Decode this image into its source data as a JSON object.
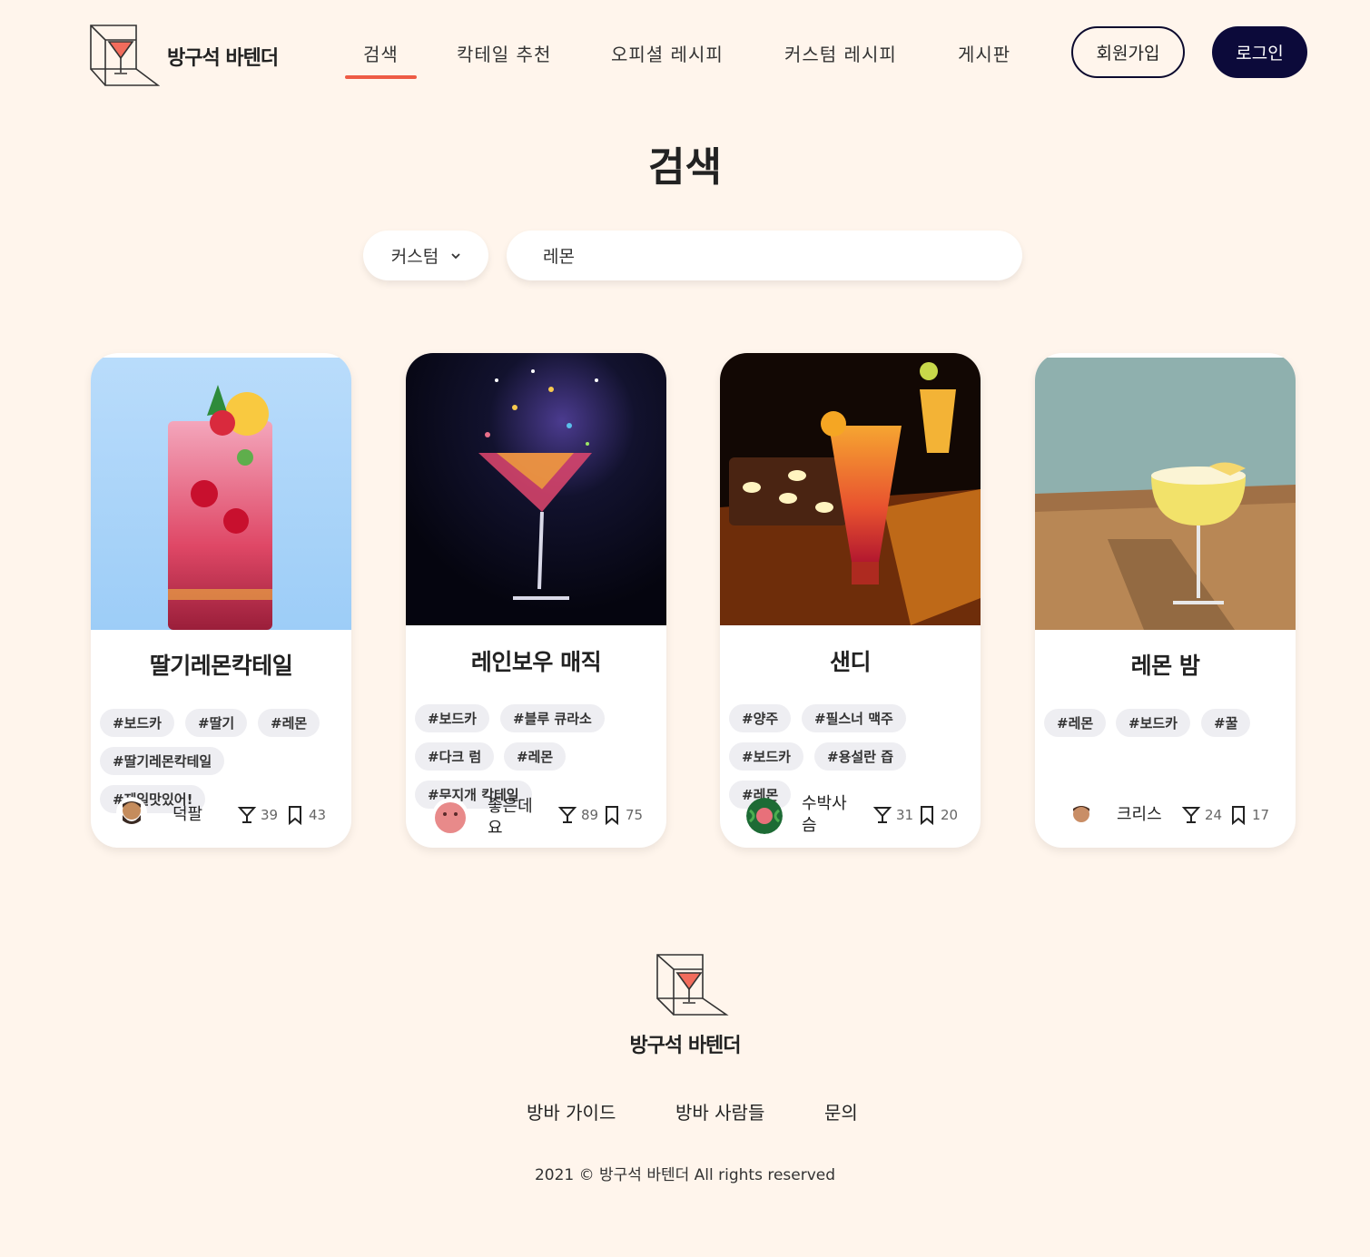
{
  "header": {
    "brand": "방구석 바텐더",
    "nav": [
      "검색",
      "칵테일 추천",
      "오피셜 레시피",
      "커스텀 레시피",
      "게시판"
    ],
    "signup": "회원가입",
    "login": "로그인"
  },
  "page": {
    "title": "검색",
    "filter_selected": "커스텀",
    "search_value": "레몬"
  },
  "cards": [
    {
      "title": "딸기레몬칵테일",
      "tags": [
        "#보드카",
        "#딸기",
        "#레몬",
        "#딸기레몬칵테일",
        "#제일맛있어!"
      ],
      "author": "덕팔",
      "likes": "39",
      "bookmarks": "43"
    },
    {
      "title": "레인보우 매직",
      "tags": [
        "#보드카",
        "#블루 큐라소",
        "#다크 럼",
        "#레몬",
        "#무지개 칵테일"
      ],
      "author": "좋은데요",
      "likes": "89",
      "bookmarks": "75"
    },
    {
      "title": "샌디",
      "tags": [
        "#양주",
        "#필스너 맥주",
        "#보드카",
        "#용설란 즙",
        "#레몬"
      ],
      "author": "수박사슴",
      "likes": "31",
      "bookmarks": "20"
    },
    {
      "title": "레몬 밤",
      "tags": [
        "#레몬",
        "#보드카",
        "#꿀"
      ],
      "author": "크리스",
      "likes": "24",
      "bookmarks": "17"
    }
  ],
  "footer": {
    "brand": "방구석 바텐더",
    "links": [
      "방바 가이드",
      "방바 사람들",
      "문의"
    ],
    "copyright": "2021 © 방구석 바텐더 All rights reserved"
  },
  "colors": {
    "background": "#fff5ec",
    "accent": "#ee5b45",
    "navy": "#0c0a3a"
  }
}
